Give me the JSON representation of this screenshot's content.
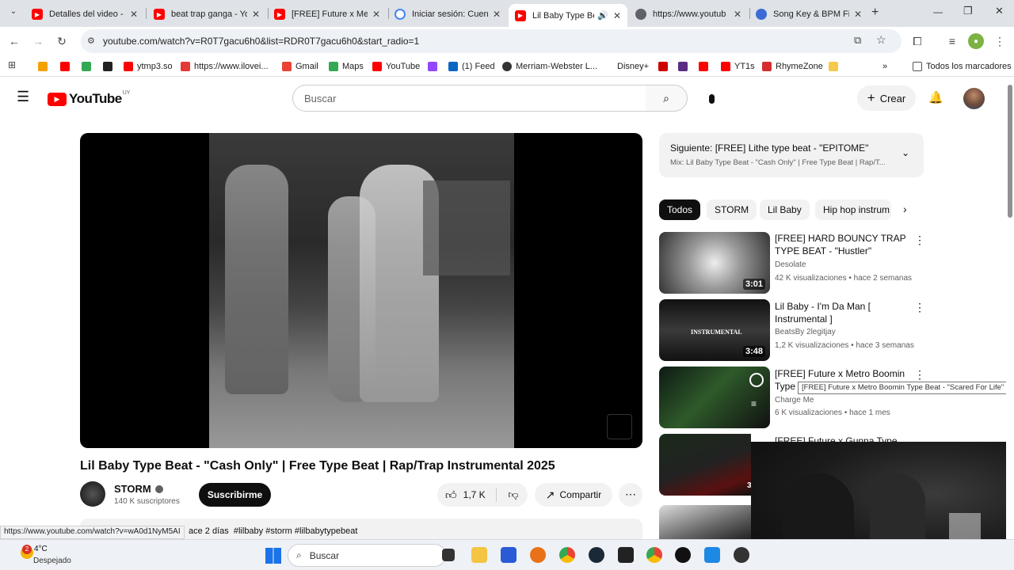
{
  "browser": {
    "tabs": [
      {
        "title": "Detalles del video - Y",
        "color": "#ff0000"
      },
      {
        "title": "beat trap ganga - Yo",
        "color": "#ff0000"
      },
      {
        "title": "[FREE] Future x Metr",
        "color": "#ff0000"
      },
      {
        "title": "Iniciar sesión: Cuenta",
        "color": "#4285f4"
      },
      {
        "title": "Lil Baby Type Be",
        "color": "#ff0000"
      },
      {
        "title": "https://www.youtub",
        "color": "#5f6368"
      },
      {
        "title": "Song Key & BPM Fin",
        "color": "#3c6bd6"
      }
    ],
    "url": "youtube.com/watch?v=R0T7gacu6h0&list=RDR0T7gacu6h0&start_radio=1",
    "bookmarks": [
      {
        "label": "",
        "color": "#f4a100"
      },
      {
        "label": "",
        "color": "#ff0000"
      },
      {
        "label": "",
        "color": "#34a853"
      },
      {
        "label": "",
        "color": "#222222"
      },
      {
        "label": "ytmp3.so",
        "color": "#ff0000"
      },
      {
        "label": "https://www.ilovei...",
        "color": "#e53935"
      },
      {
        "label": "Gmail",
        "color": "#ea4335"
      },
      {
        "label": "Maps",
        "color": "#34a853"
      },
      {
        "label": "YouTube",
        "color": "#ff0000"
      },
      {
        "label": "",
        "color": "#9146ff"
      },
      {
        "label": "(1) Feed",
        "color": "#0a66c2"
      },
      {
        "label": "Merriam-Webster L...",
        "color": "#333333"
      },
      {
        "label": "Disney+",
        "color": "#113ccf"
      },
      {
        "label": "",
        "color": "#cc0000"
      },
      {
        "label": "",
        "color": "#5b2c83"
      },
      {
        "label": "",
        "color": "#ff0000"
      },
      {
        "label": "YT1s",
        "color": "#ff0000"
      },
      {
        "label": "RhymeZone",
        "color": "#d32f2f"
      },
      {
        "label": "",
        "color": "#f6c94a"
      }
    ],
    "all_bookmarks": "Todos los marcadores"
  },
  "youtube": {
    "logo_text": "YouTube",
    "logo_country": "UY",
    "search_placeholder": "Buscar",
    "create_label": "Crear"
  },
  "video": {
    "title": "Lil Baby Type Beat - \"Cash Only\" | Free Type Beat | Rap/Trap Instrumental 2025",
    "channel": "STORM",
    "subscribers": "140 K suscriptores",
    "subscribe_label": "Suscribirme",
    "likes": "1,7 K",
    "share_label": "Compartir",
    "description_line": "ace 2 días  #lilbaby #storm #lilbabytypebeat"
  },
  "up_next": {
    "next_label": "Siguiente: [FREE] Lithe type beat - \"EPITOME\"",
    "mix_label": "Mix: Lil Baby Type Beat - \"Cash Only\" | Free Type Beat | Rap/T..."
  },
  "chips": [
    "Todos",
    "STORM",
    "Lil Baby",
    "Hip hop instrum"
  ],
  "recommendations": [
    {
      "title": "[FREE] HARD BOUNCY TRAP TYPE BEAT - \"Hustler\"",
      "channel": "Desolate",
      "meta": "42 K visualizaciones • hace 2 semanas",
      "duration": "3:01",
      "thumb": "#8a8a8a"
    },
    {
      "title": "Lil Baby - I'm Da Man [ Instrumental ]",
      "channel": "BeatsBy 2legitjay",
      "meta": "1,2 K visualizaciones • hace 3 semanas",
      "duration": "3:48",
      "thumb": "#2b2b2b",
      "badge": "INSTRUMENTAL"
    },
    {
      "title": "[FREE] Future x Metro Boomin Type",
      "channel": "Charge Me",
      "meta": "6 K visualizaciones • hace 1 mes",
      "duration": "",
      "thumb": "#1e2a1e"
    },
    {
      "title": "[FREE] Future x Gunna Type",
      "channel": "",
      "meta": "",
      "duration": "3",
      "thumb": "#1a1a22"
    },
    {
      "title": "",
      "channel": "",
      "meta": "",
      "duration": "",
      "thumb": "#333333"
    }
  ],
  "tooltip": "[FREE] Future x Metro Boomin Type Beat - \"Scared For Life\"",
  "status_url": "https://www.youtube.com/watch?v=wA0d1NyM5AI",
  "taskbar": {
    "weather_temp": "4°C",
    "weather_desc": "Despejado",
    "search_placeholder": "Buscar",
    "weather_badge": "2"
  }
}
